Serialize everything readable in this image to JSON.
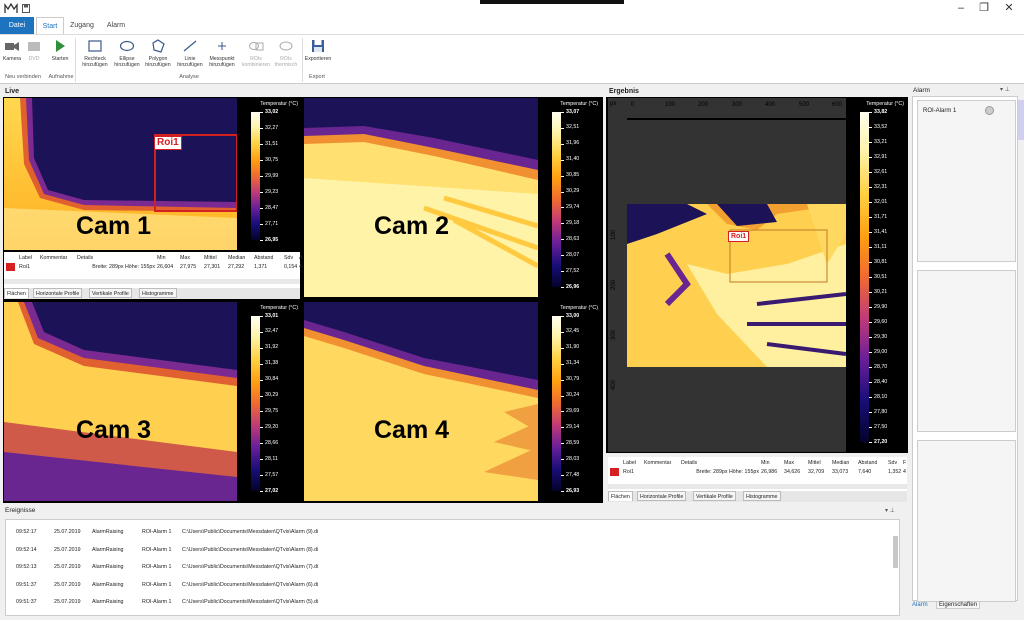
{
  "titlebar": {
    "minimize": "–",
    "maximize": "❐",
    "close": "✕"
  },
  "tabs": [
    {
      "label": "Datei"
    },
    {
      "label": "Start"
    },
    {
      "label": "Zugang"
    },
    {
      "label": "Alarm"
    }
  ],
  "ribbon": {
    "camera": "Kamera",
    "dvd": "DVD",
    "start": "Starten",
    "rect": [
      "Rechteck",
      "hinzufügen"
    ],
    "ellipse": [
      "Ellipse",
      "hinzufügen"
    ],
    "polygon": [
      "Polygon",
      "hinzufügen"
    ],
    "line": [
      "Linie",
      "hinzufügen"
    ],
    "point": [
      "Messpunkt",
      "hinzufügen"
    ],
    "roi_combine": [
      "ROIs",
      "kombinieren"
    ],
    "roi_thermal": [
      "ROIs",
      "thermisch"
    ],
    "export": "Exportieren",
    "groups": {
      "reconnect": "Neu verbinden",
      "record": "Aufnahme",
      "analysis": "Analyse",
      "export": "Export"
    }
  },
  "live": {
    "title": "Live"
  },
  "result": {
    "title": "Ergebnis"
  },
  "colorbar_title": "Temperatur (°C)",
  "cams": [
    {
      "label": "Cam 1",
      "ticks": [
        "33,02",
        "32,27",
        "31,51",
        "30,75",
        "29,99",
        "29,23",
        "28,47",
        "27,71",
        "26,95"
      ],
      "roi": "Roi1"
    },
    {
      "label": "Cam 2",
      "ticks": [
        "33,07",
        "32,51",
        "31,96",
        "31,40",
        "30,85",
        "30,29",
        "29,74",
        "29,18",
        "28,63",
        "28,07",
        "27,52",
        "26,96"
      ]
    },
    {
      "label": "Cam 3",
      "ticks": [
        "33,01",
        "32,47",
        "31,92",
        "31,38",
        "30,84",
        "30,29",
        "29,75",
        "29,20",
        "28,66",
        "28,11",
        "27,57",
        "27,02"
      ]
    },
    {
      "label": "Cam 4",
      "ticks": [
        "33,00",
        "32,45",
        "31,90",
        "31,34",
        "30,79",
        "30,24",
        "29,69",
        "29,14",
        "28,59",
        "28,03",
        "27,48",
        "26,93"
      ]
    }
  ],
  "result_ticks": [
    "33,82",
    "33,52",
    "33,21",
    "32,91",
    "32,61",
    "32,31",
    "32,01",
    "31,71",
    "31,41",
    "31,11",
    "30,81",
    "30,51",
    "30,21",
    "29,90",
    "29,60",
    "29,30",
    "29,00",
    "28,70",
    "28,40",
    "28,10",
    "27,80",
    "27,50",
    "27,20"
  ],
  "axis": {
    "unit": "px",
    "x": [
      "0",
      "100",
      "200",
      "300",
      "400",
      "500",
      "600"
    ],
    "y": [
      "100",
      "200",
      "300",
      "400"
    ]
  },
  "live_table": {
    "headers": [
      "Label",
      "Kommentar",
      "Details",
      "Min",
      "Max",
      "Mittel",
      "Median",
      "Abstand",
      "Sdv",
      "A"
    ],
    "row": [
      "Roi1",
      "",
      "Breite: 289px Höhe: 155px",
      "26,604",
      "27,975",
      "27,301",
      "27,292",
      "1,371",
      "0,154",
      "4"
    ]
  },
  "result_table": {
    "headers": [
      "Label",
      "Kommentar",
      "Details",
      "Min",
      "Max",
      "Mittel",
      "Median",
      "Abstand",
      "Sdv",
      "F"
    ],
    "row": [
      "Roi1",
      "",
      "Breite: 289px Höhe: 155px",
      "26,986",
      "34,626",
      "32,709",
      "33,073",
      "7,640",
      "1,352",
      "4"
    ]
  },
  "bottom_tabs": [
    "Flächen",
    "Horizontale Profile",
    "Vertikale Profile",
    "Histogramme"
  ],
  "events": {
    "title": "Ereignisse",
    "rows": [
      {
        "time": "09:52:17",
        "date": "25.07.2019",
        "type": "AlarmRaising",
        "name": "ROI-Alarm 1",
        "path": "C:\\Users\\Public\\Documents\\Messdaten\\QTvis\\Alarm (9).di"
      },
      {
        "time": "09:52:14",
        "date": "25.07.2019",
        "type": "AlarmRaising",
        "name": "ROI-Alarm 1",
        "path": "C:\\Users\\Public\\Documents\\Messdaten\\QTvis\\Alarm (8).di"
      },
      {
        "time": "09:52:13",
        "date": "25.07.2019",
        "type": "AlarmRaising",
        "name": "ROI-Alarm 1",
        "path": "C:\\Users\\Public\\Documents\\Messdaten\\QTvis\\Alarm (7).di"
      },
      {
        "time": "09:51:37",
        "date": "25.07.2019",
        "type": "AlarmRaising",
        "name": "ROI-Alarm 1",
        "path": "C:\\Users\\Public\\Documents\\Messdaten\\QTvis\\Alarm (6).di"
      },
      {
        "time": "09:51:37",
        "date": "25.07.2019",
        "type": "AlarmRaising",
        "name": "ROI-Alarm 1",
        "path": "C:\\Users\\Public\\Documents\\Messdaten\\QTvis\\Alarm (5).di"
      }
    ]
  },
  "alarm": {
    "title": "Alarm",
    "item": "ROI-Alarm 1",
    "tabs": [
      "Alarm",
      "Eigenschaften"
    ]
  },
  "colors": {
    "accent": "#1e73be",
    "roi": "#d42020"
  }
}
